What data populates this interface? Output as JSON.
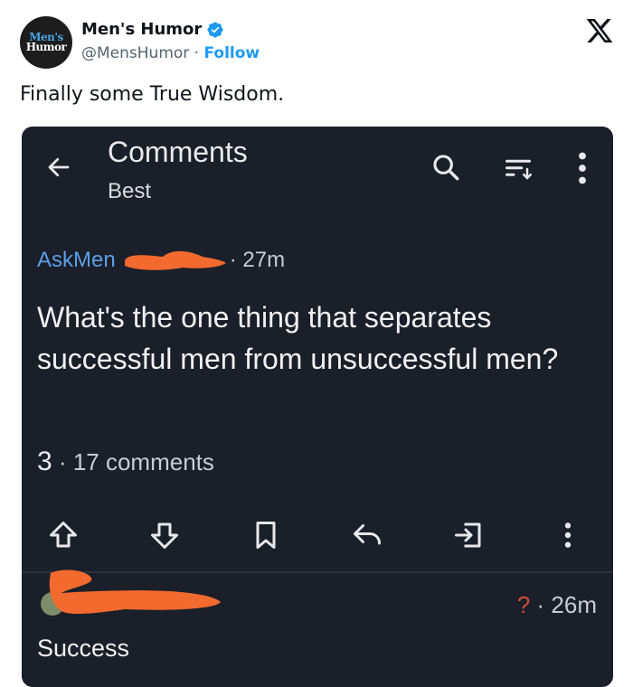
{
  "tweet": {
    "avatar_line1": "Men's",
    "avatar_line2": "Humor",
    "display_name": "Men's Humor",
    "handle": "@MensHumor",
    "separator": "·",
    "follow_label": "Follow",
    "text": "Finally some True Wisdom."
  },
  "screenshot": {
    "header": {
      "title": "Comments",
      "subtitle": "Best"
    },
    "post": {
      "subreddit": "AskMen",
      "time": "27m",
      "title": "What's the one thing that separates successful men from unsuccessful men?",
      "score": "3",
      "comments": "17 comments",
      "dot": "·"
    },
    "comment": {
      "score": "?",
      "dot": "·",
      "time": "26m",
      "body": "Success"
    }
  },
  "colors": {
    "accent": "#1d9bf0",
    "dark_bg": "#1b1f29",
    "subreddit": "#5a9fe6",
    "redaction": "#f26a2e"
  }
}
